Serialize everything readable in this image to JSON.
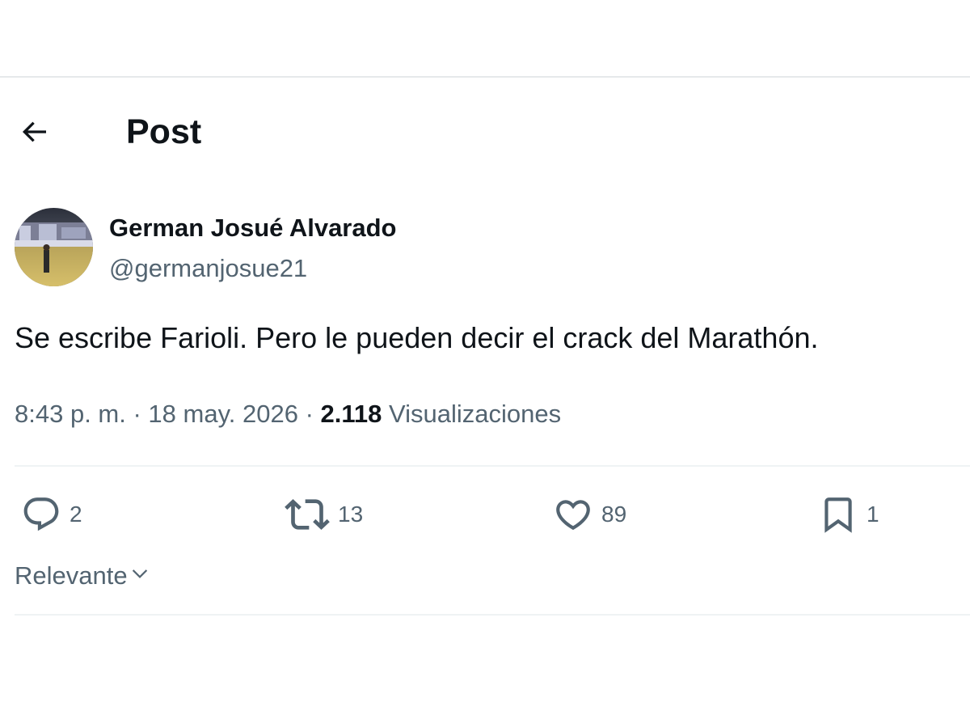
{
  "header": {
    "title": "Post",
    "back_icon": "arrow-left-icon"
  },
  "author": {
    "display_name": "German Josué Alvarado",
    "handle": "@germanjosue21",
    "avatar_icon": "profile-photo-stadium"
  },
  "tweet": {
    "text": "Se escribe Farioli. Pero le pueden decir el crack del Marathón."
  },
  "meta": {
    "time": "8:43 p. m.",
    "separator": " · ",
    "date": "18 may. 2026",
    "views_count": "2.118",
    "views_label": "Visualizaciones"
  },
  "actions": {
    "replies": {
      "icon": "reply-icon",
      "count": "2"
    },
    "reposts": {
      "icon": "repost-icon",
      "count": "13"
    },
    "likes": {
      "icon": "heart-icon",
      "count": "89"
    },
    "bookmarks": {
      "icon": "bookmark-icon",
      "count": "1"
    }
  },
  "sort": {
    "label": "Relevante",
    "icon": "chevron-down-icon"
  },
  "colors": {
    "text_primary": "#0f1419",
    "text_secondary": "#536471",
    "divider": "#eff3f4"
  }
}
